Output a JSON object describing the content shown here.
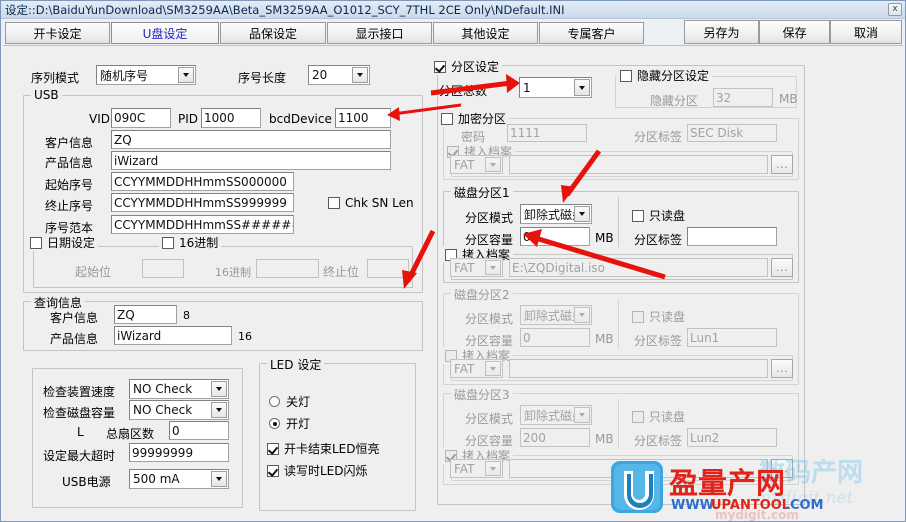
{
  "window": {
    "title": "设定::D:\\BaiduYunDownload\\SM3259AA\\Beta_SM3259AA_O1012_SCY_7THL 2CE Only\\NDefault.INI",
    "close_label": "x"
  },
  "tabs": [
    {
      "label": "开卡设定",
      "active": false
    },
    {
      "label": "U盘设定",
      "active": true
    },
    {
      "label": "品保设定",
      "active": false
    },
    {
      "label": "显示接口",
      "active": false
    },
    {
      "label": "其他设定",
      "active": false
    },
    {
      "label": "专属客户",
      "active": false
    }
  ],
  "top_buttons": [
    {
      "label": "另存为"
    },
    {
      "label": "保存"
    },
    {
      "label": "取消"
    }
  ],
  "serial": {
    "mode_label": "序列模式",
    "mode_value": "随机序号",
    "len_label": "序号长度",
    "len_value": "20"
  },
  "usb": {
    "title": "USB",
    "vid_label": "VID",
    "vid_value": "090C",
    "pid_label": "PID",
    "pid_value": "1000",
    "bcd_label": "bcdDevice",
    "bcd_value": "1100",
    "customer_label": "客户信息",
    "customer_value": "ZQ",
    "product_label": "产品信息",
    "product_value": "iWizard",
    "start_sn_label": "起始序号",
    "start_sn_value": "CCYYMMDDHHmmSS000000",
    "end_sn_label": "终止序号",
    "end_sn_value": "CCYYMMDDHHmmSS999999",
    "sn_pattern_label": "序号范本",
    "sn_pattern_value": "CCYYMMDDHHmmSS######",
    "chk_sn_len_label": "Chk SN Len",
    "chk_sn_len_checked": false,
    "date_group_label": "日期设定",
    "date_group_checked": false,
    "hex_label": "16进制",
    "hex_checked": false,
    "start_pos_label": "起始位",
    "start_pos_value": "",
    "hex2_label": "16进制",
    "hex2_value": "",
    "end_pos_label": "终止位",
    "end_pos_value": ""
  },
  "query": {
    "title": "查询信息",
    "customer_label": "客户信息",
    "customer_value": "ZQ",
    "customer_count": "8",
    "product_label": "产品信息",
    "product_value": "iWizard",
    "product_count": "16"
  },
  "check": {
    "speed_label": "检查装置速度",
    "speed_value": "NO Check",
    "capacity_label": "检查磁盘容量",
    "capacity_value": "NO Check",
    "l_label": "L",
    "sectors_label": "总扇区数",
    "sectors_value": "0",
    "timeout_label": "设定最大超时",
    "timeout_value": "99999999",
    "power_label": "USB电源",
    "power_value": "500 mA"
  },
  "led": {
    "title": "LED 设定",
    "off_label": "关灯",
    "on_label": "开灯",
    "selected": "开灯",
    "after_label": "开卡结束LED恒亮",
    "after_checked": true,
    "rw_label": "读写时LED闪烁",
    "rw_checked": true
  },
  "partition": {
    "title": "分区设定",
    "enabled": true,
    "count_label": "分区总数",
    "count_value": "1",
    "hidden": {
      "title": "隐藏分区设定",
      "enabled": false,
      "size_label": "隐藏分区",
      "size_value": "32",
      "unit": "MB"
    },
    "encrypt": {
      "title": "加密分区",
      "enabled": false,
      "password_label": "密码",
      "password_value": "1111",
      "label_label": "分区标签",
      "label_value": "SEC Disk",
      "copy_label": "拷入档案",
      "copy_checked": true,
      "fs_value": "FAT",
      "file_value": "",
      "browse_label": "..."
    },
    "disks": [
      {
        "title": "磁盘分区1",
        "disabled": false,
        "mode_label": "分区模式",
        "mode_value": "卸除式磁盘",
        "size_label": "分区容量",
        "size_value": "0",
        "unit": "MB",
        "readonly_label": "只读盘",
        "readonly_checked": false,
        "label_label": "分区标签",
        "label_value": "",
        "copy_label": "拷入档案",
        "copy_checked": false,
        "fs_value": "FAT",
        "file_value": "E:\\ZQDigital.iso",
        "browse_label": "..."
      },
      {
        "title": "磁盘分区2",
        "disabled": true,
        "mode_label": "分区模式",
        "mode_value": "卸除式磁盘",
        "size_label": "分区容量",
        "size_value": "0",
        "unit": "MB",
        "readonly_label": "只读盘",
        "readonly_checked": false,
        "label_label": "分区标签",
        "label_value": "Lun1",
        "copy_label": "拷入档案",
        "copy_checked": false,
        "fs_value": "FAT",
        "file_value": "",
        "browse_label": "..."
      },
      {
        "title": "磁盘分区3",
        "disabled": true,
        "mode_label": "分区模式",
        "mode_value": "卸除式磁盘",
        "size_label": "分区容量",
        "size_value": "200",
        "unit": "MB",
        "readonly_label": "只读盘",
        "readonly_checked": false,
        "label_label": "分区标签",
        "label_value": "Lun2",
        "copy_label": "拷入档案",
        "copy_checked": true,
        "fs_value": "FAT",
        "file_value": "",
        "browse_label": "..."
      }
    ]
  },
  "watermark": {
    "cn_text": "盈量产网",
    "url_www": "WWW.",
    "url_main": "UPANTOOL",
    "url_com": ".COM",
    "ghost_text": "数码产网",
    "ghost_url": "mydigit.net"
  },
  "colors": {
    "accent": "#2222cc",
    "annotation": "#e8120c",
    "titlebar": "#d7e2f0",
    "logo_blue": "#2f9ede",
    "logo_red": "#e2231a"
  }
}
